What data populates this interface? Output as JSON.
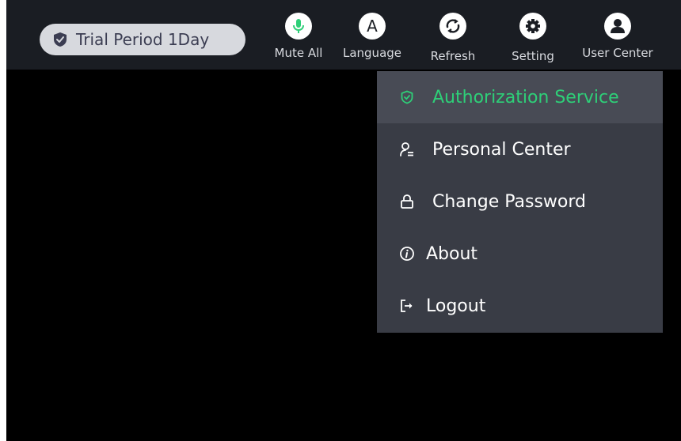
{
  "header": {
    "trial_badge": "Trial Period 1Day"
  },
  "toolbar": {
    "mute_all": "Mute All",
    "language": "Language",
    "language_letter": "A",
    "refresh": "Refresh",
    "setting": "Setting",
    "user_center": "User Center"
  },
  "user_menu": {
    "items": [
      {
        "label": "Authorization Service",
        "icon": "shield-check-icon",
        "active": true
      },
      {
        "label": "Personal Center",
        "icon": "person-icon"
      },
      {
        "label": "Change Password",
        "icon": "lock-icon"
      },
      {
        "label": "About",
        "icon": "info-icon"
      },
      {
        "label": "Logout",
        "icon": "logout-icon"
      }
    ]
  },
  "colors": {
    "topbar": "#1a1d23",
    "menu_bg": "#393c45",
    "menu_active_bg": "#484b55",
    "accent_green": "#2ecf78",
    "badge_bg": "#d7d9de",
    "badge_text": "#3b3d52"
  }
}
